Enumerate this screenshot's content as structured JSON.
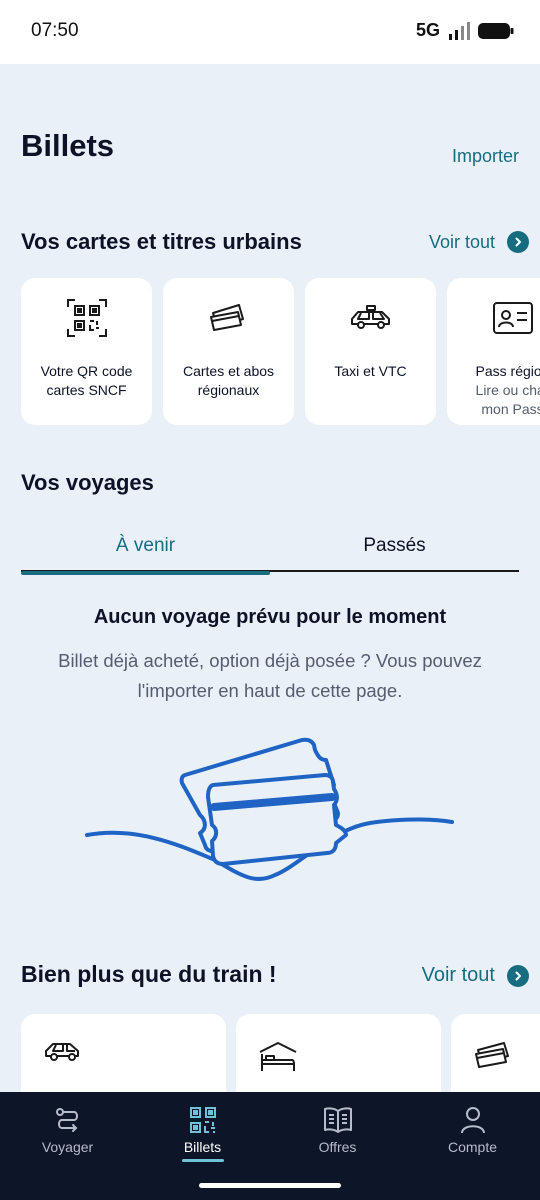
{
  "status_bar": {
    "time": "07:50",
    "network": "5G"
  },
  "header": {
    "title": "Billets",
    "import_label": "Importer"
  },
  "urban_section": {
    "title": "Vos cartes et titres urbains",
    "see_all": "Voir tout",
    "cards": [
      {
        "title": "Votre QR code\ncartes SNCF",
        "icon": "qr-code-icon"
      },
      {
        "title": "Cartes et abos\nrégionaux",
        "icon": "cards-icon"
      },
      {
        "title": "Taxi et VTC",
        "icon": "taxi-icon"
      },
      {
        "title": "Pass région",
        "subtitle": "Lire ou char\nmon Pass",
        "icon": "id-card-icon"
      }
    ]
  },
  "trips_section": {
    "title": "Vos voyages",
    "tabs": [
      {
        "label": "À venir",
        "active": true
      },
      {
        "label": "Passés",
        "active": false
      }
    ],
    "empty_title": "Aucun voyage prévu pour le moment",
    "empty_text": "Billet déjà acheté, option déjà posée ? Vous pouvez l'importer en haut de cette page."
  },
  "more_section": {
    "title": "Bien plus que du train !",
    "see_all": "Voir tout",
    "cards": [
      {
        "icon": "car-icon"
      },
      {
        "icon": "bed-icon"
      },
      {
        "icon": "cards-icon"
      }
    ]
  },
  "bottom_nav": {
    "items": [
      {
        "label": "Voyager",
        "icon": "route-icon",
        "active": false
      },
      {
        "label": "Billets",
        "icon": "qr-code-icon",
        "active": true
      },
      {
        "label": "Offres",
        "icon": "book-icon",
        "active": false
      },
      {
        "label": "Compte",
        "icon": "user-icon",
        "active": false
      }
    ]
  },
  "colors": {
    "accent": "#176d80",
    "background": "#e9f0f8",
    "nav_background": "#0d1628",
    "illustration": "#1f63c4"
  }
}
